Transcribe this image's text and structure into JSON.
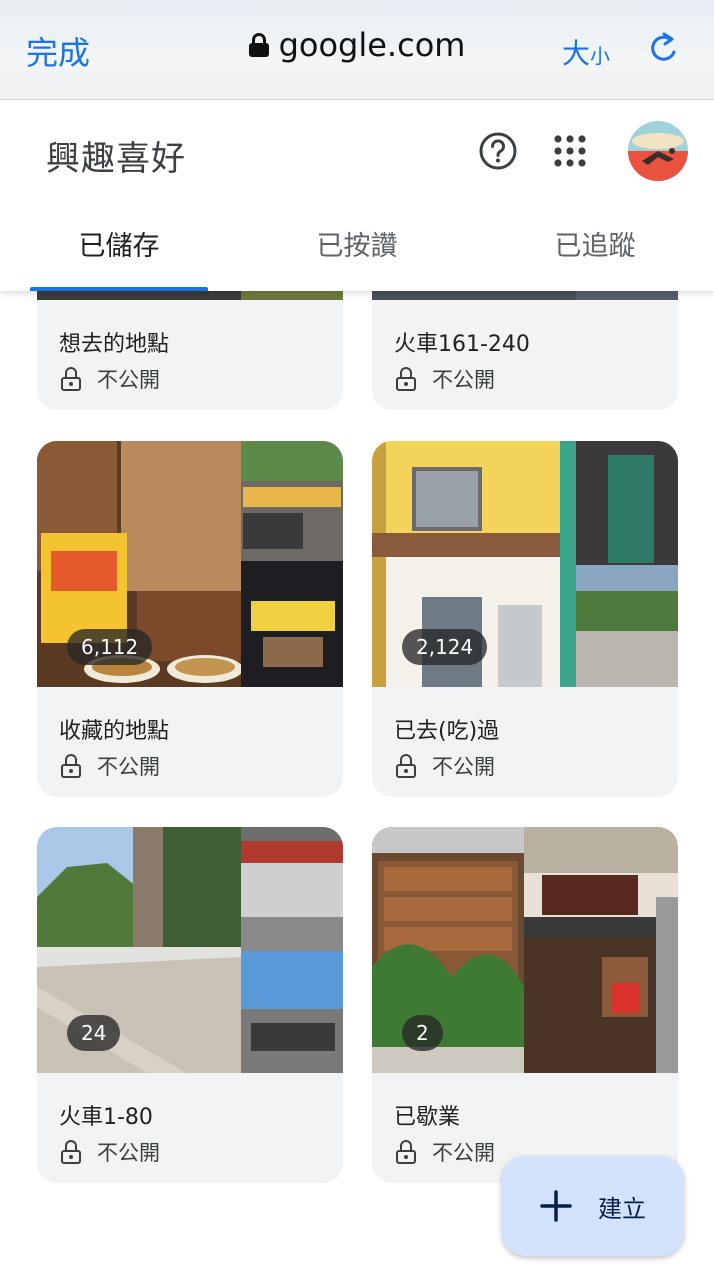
{
  "browser": {
    "done_label": "完成",
    "url": "google.com",
    "text_size_big": "大",
    "text_size_small": "小"
  },
  "header": {
    "title": "興趣喜好"
  },
  "tabs": [
    {
      "label": "已儲存",
      "active": true
    },
    {
      "label": "已按讚",
      "active": false
    },
    {
      "label": "已追蹤",
      "active": false
    }
  ],
  "lists": [
    {
      "name": "想去的地點",
      "privacy": "不公開",
      "count": ""
    },
    {
      "name": "火車161-240",
      "privacy": "不公開",
      "count": ""
    },
    {
      "name": "收藏的地點",
      "privacy": "不公開",
      "count": "6,112"
    },
    {
      "name": "已去(吃)過",
      "privacy": "不公開",
      "count": "2,124"
    },
    {
      "name": "火車1-80",
      "privacy": "不公開",
      "count": "24"
    },
    {
      "name": "已歇業",
      "privacy": "不公開",
      "count": "2"
    }
  ],
  "fab": {
    "label": "建立"
  },
  "colors": {
    "accent": "#1a73e8",
    "card_bg": "#f1f3f4",
    "fab_bg": "#d3e3fd"
  }
}
